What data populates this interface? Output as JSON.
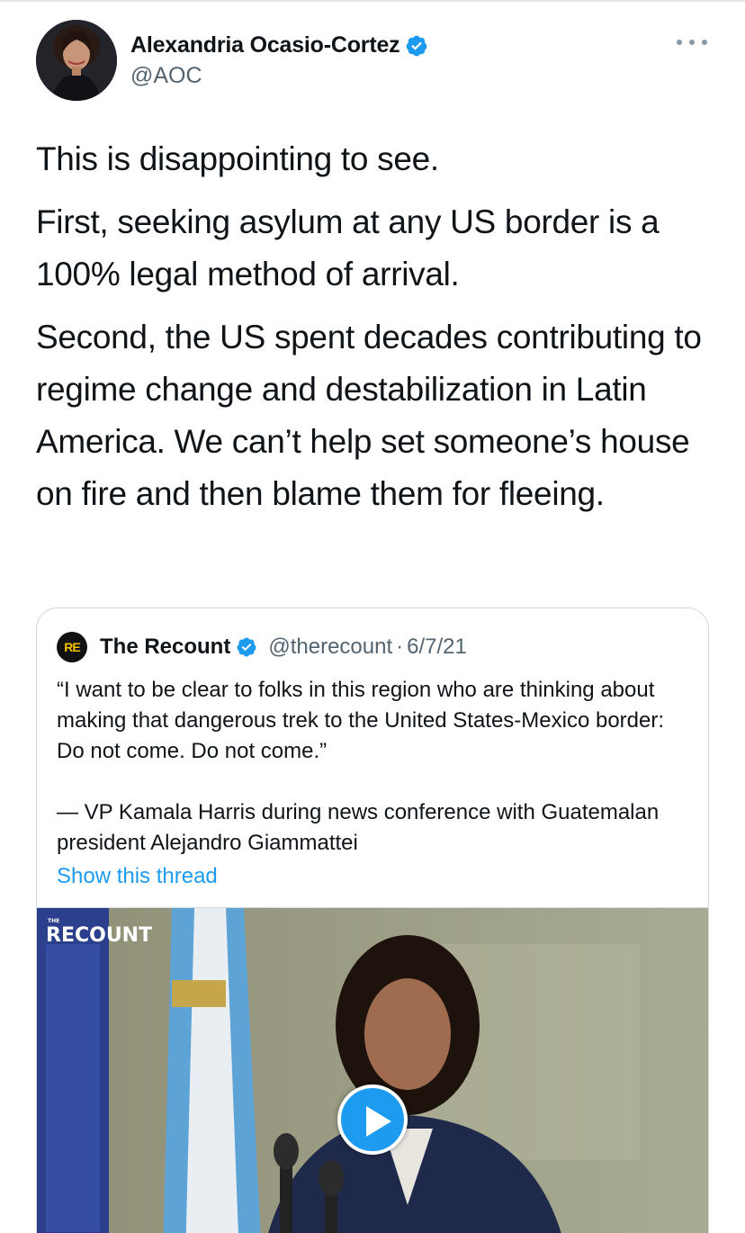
{
  "author": {
    "display_name": "Alexandria Ocasio-Cortez",
    "handle": "@AOC",
    "verified": true
  },
  "tweet": {
    "paragraphs": [
      "This is disappointing to see.",
      "First, seeking asylum at any US border is a 100% legal method of arrival.",
      "Second, the US spent decades contributing to regime change and destabilization in Latin America. We can’t help set someone’s house on fire and then blame them for fleeing."
    ]
  },
  "quoted_tweet": {
    "logo_text": "RE",
    "display_name": "The Recount",
    "verified": true,
    "handle": "@therecount",
    "separator": "·",
    "date": "6/7/21",
    "paragraphs": [
      "“I want to be clear to folks in this region who are thinking about making that dangerous trek to the United States-Mexico border: Do not come. Do not come.”",
      "— VP Kamala Harris during news conference with Guatemalan president Alejandro Giammattei"
    ],
    "show_thread_label": "Show this thread",
    "media": {
      "watermark_small": "THE",
      "watermark_large": "RECOUNT",
      "type": "video"
    }
  },
  "colors": {
    "accent": "#1d9bf0",
    "secondary_text": "#536471",
    "border": "#cfd9de"
  },
  "icons": {
    "verified": "verified-badge-icon",
    "more": "more-options-icon",
    "play": "play-icon"
  }
}
